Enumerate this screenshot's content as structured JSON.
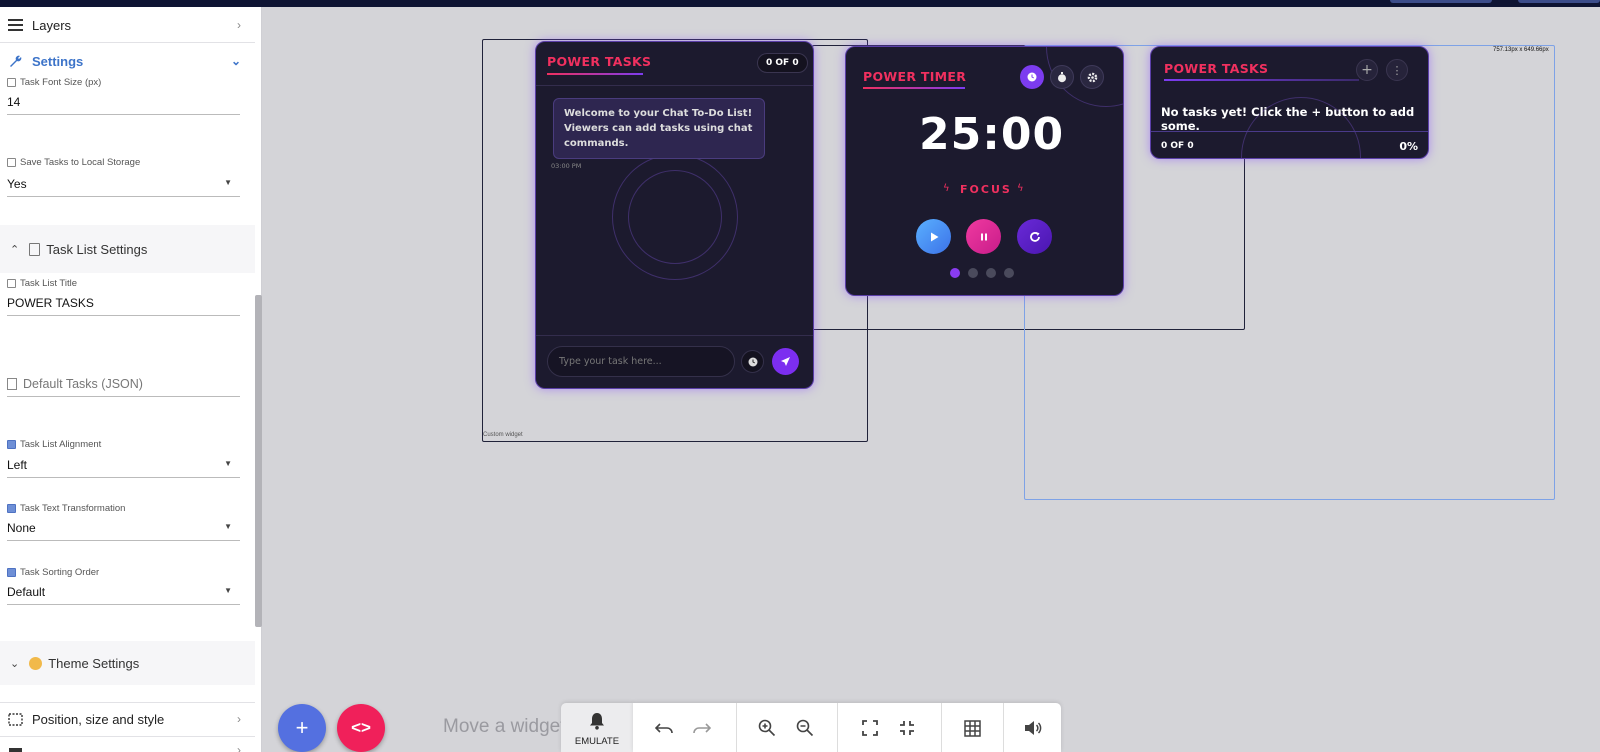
{
  "sidebar": {
    "layers_label": "Layers",
    "settings_label": "Settings",
    "fields": {
      "font_size_label": "Task Font Size (px)",
      "font_size_value": "14",
      "save_label": "Save Tasks to Local Storage",
      "save_value": "Yes",
      "title_label": "Task List Title",
      "title_value": "POWER TASKS",
      "default_tasks_placeholder": "Default Tasks (JSON)",
      "alignment_label": "Task List Alignment",
      "alignment_value": "Left",
      "transform_label": "Task Text Transformation",
      "transform_value": "None",
      "sorting_label": "Task Sorting Order",
      "sorting_value": "Default"
    },
    "task_list_settings_label": "Task List Settings",
    "theme_settings_label": "Theme Settings",
    "position_label": "Position, size and style"
  },
  "canvas": {
    "frame1_caption": "Custom widget",
    "frame3_dims": "757.13px x 649.66px",
    "tasks_widget": {
      "title": "POWER TASKS",
      "count": "0 OF 0",
      "welcome": "Welcome to your Chat To-Do List! Viewers can add tasks using chat commands.",
      "time": "03:00 PM",
      "input_placeholder": "Type your task here..."
    },
    "timer_widget": {
      "title": "POWER TIMER",
      "time": "25:00",
      "mode": "FOCUS"
    },
    "tasks_widget2": {
      "title": "POWER TASKS",
      "empty": "No tasks yet! Click the + button to add some.",
      "count": "0 OF 0",
      "percent": "0%"
    }
  },
  "toolbar": {
    "hint": "Move a widget",
    "emulate_label": "EMULATE"
  },
  "colors": {
    "accent_red": "#f0305f",
    "accent_purple": "#7c3cf0",
    "fab_blue": "#5470e0",
    "fab_red": "#f0205a"
  }
}
